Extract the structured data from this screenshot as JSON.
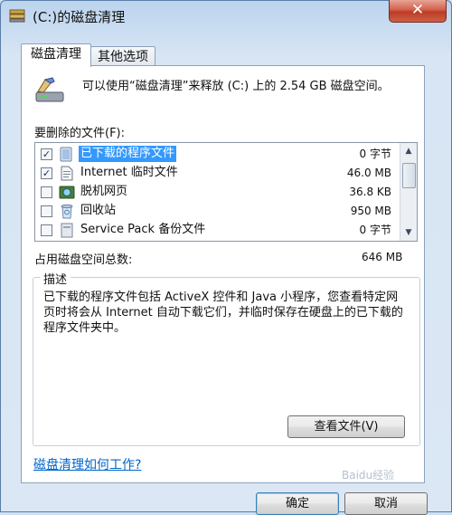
{
  "window": {
    "title": "(C:)的磁盘清理",
    "close_glyph": "✕"
  },
  "tabs": [
    {
      "label": "磁盘清理"
    },
    {
      "label": "其他选项"
    }
  ],
  "summary": "可以使用“磁盘清理”来释放 (C:) 上的 2.54 GB 磁盘空间。",
  "files_label": "要删除的文件(F):",
  "files": [
    {
      "name": "已下载的程序文件",
      "size": "0 字节",
      "checked": true,
      "selected": true,
      "icon": "folder-icon"
    },
    {
      "name": "Internet 临时文件",
      "size": "46.0 MB",
      "checked": true,
      "selected": false,
      "icon": "document-icon"
    },
    {
      "name": "脱机网页",
      "size": "36.8 KB",
      "checked": false,
      "selected": false,
      "icon": "offline-pages-icon"
    },
    {
      "name": "回收站",
      "size": "950 MB",
      "checked": false,
      "selected": false,
      "icon": "recycle-bin-icon"
    },
    {
      "name": "Service Pack 备份文件",
      "size": "0 字节",
      "checked": false,
      "selected": false,
      "icon": "backup-icon"
    }
  ],
  "total": {
    "label": "占用磁盘空间总数:",
    "value": "646 MB"
  },
  "description": {
    "legend": "描述",
    "text": "已下载的程序文件包括 ActiveX 控件和 Java 小程序，您查看特定网页时将会从 Internet 自动下载它们，并临时保存在硬盘上的已下载的程序文件夹中。"
  },
  "view_files_button": "查看文件(V)",
  "help_link": "磁盘清理如何工作?",
  "ok_button": "确定",
  "cancel_button": "取消",
  "check_glyph": "✓",
  "watermark": "Baidu经验"
}
